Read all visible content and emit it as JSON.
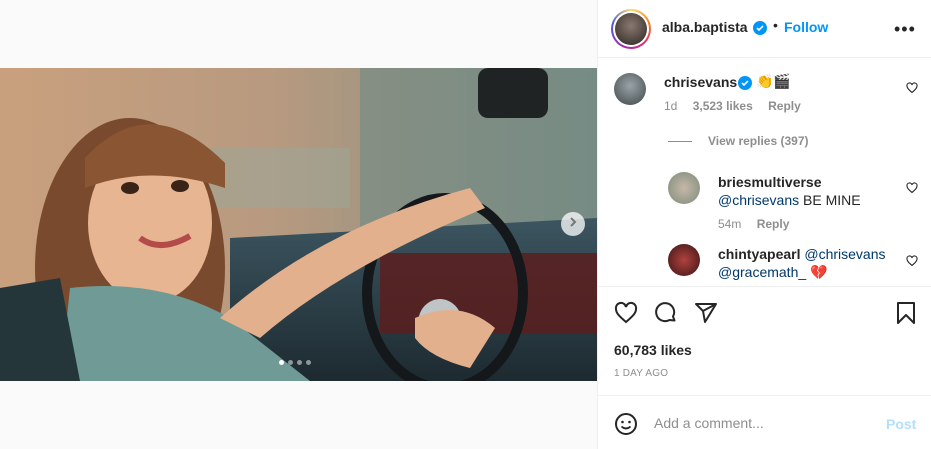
{
  "post": {
    "author": "alba.baptista",
    "follow_label": "Follow",
    "separator": "•",
    "more_label": "•••",
    "carousel": {
      "total_slides": 4,
      "active_slide": 1
    }
  },
  "comments": [
    {
      "user": "chrisevans",
      "text": "👏🎬",
      "age": "1d",
      "likes": "3,523 likes",
      "reply_label": "Reply"
    }
  ],
  "view_replies_label": "View replies (397)",
  "replies": [
    {
      "user": "briesmultiverse",
      "mention": "@chrisevans",
      "text": " BE MINE",
      "age": "54m",
      "reply_label": "Reply"
    },
    {
      "user": "chintyapearl",
      "mention": "@chrisevans",
      "mention2": "@gracemath_",
      "text": " 💔"
    }
  ],
  "likes_count": "60,783 likes",
  "posted_ago": "1 DAY AGO",
  "add_comment": {
    "placeholder": "Add a comment...",
    "post_label": "Post"
  },
  "colors": {
    "link_blue": "#0095f6",
    "post_disabled": "#b2dffc",
    "meta_gray": "#8e8e8e",
    "verified_blue": "#0095f6"
  },
  "icons": [
    "chevron-right-icon",
    "verified-badge-icon",
    "heart-icon",
    "comment-icon",
    "share-icon",
    "bookmark-icon",
    "emoji-icon",
    "more-icon"
  ]
}
